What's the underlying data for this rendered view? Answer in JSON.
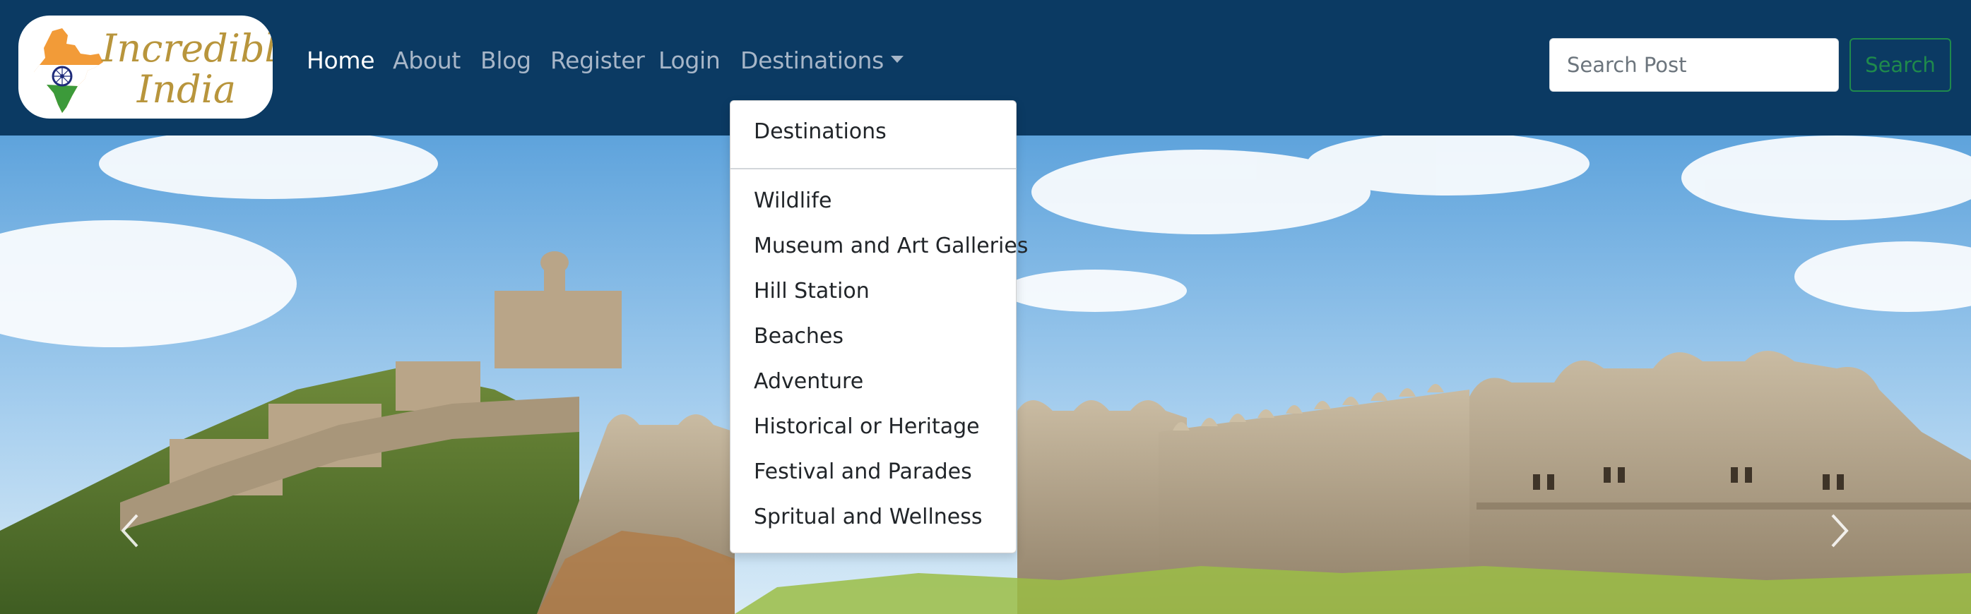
{
  "brand": {
    "line1": "Incredible",
    "line2": "India"
  },
  "nav": {
    "items": [
      {
        "label": "Home",
        "active": true
      },
      {
        "label": "About"
      },
      {
        "label": "Blog"
      },
      {
        "label": "Register"
      },
      {
        "label": "Login"
      },
      {
        "label": "Destinations",
        "has_dropdown": true
      }
    ]
  },
  "search": {
    "placeholder": "Search Post",
    "value": "",
    "button_label": "Search"
  },
  "dropdown": {
    "header": "Destinations",
    "items": [
      "Wildlife",
      "Museum and Art Galleries",
      "Hill Station",
      "Beaches",
      "Adventure",
      "Historical or Heritage",
      "Festival and Parades",
      "Spritual and Wellness"
    ]
  },
  "carousel": {
    "prev_icon": "chevron-left-icon",
    "next_icon": "chevron-right-icon"
  },
  "colors": {
    "navbar_bg": "#0b3a63",
    "brand_gold": "#b8953c",
    "search_green": "#1f8a4c"
  }
}
